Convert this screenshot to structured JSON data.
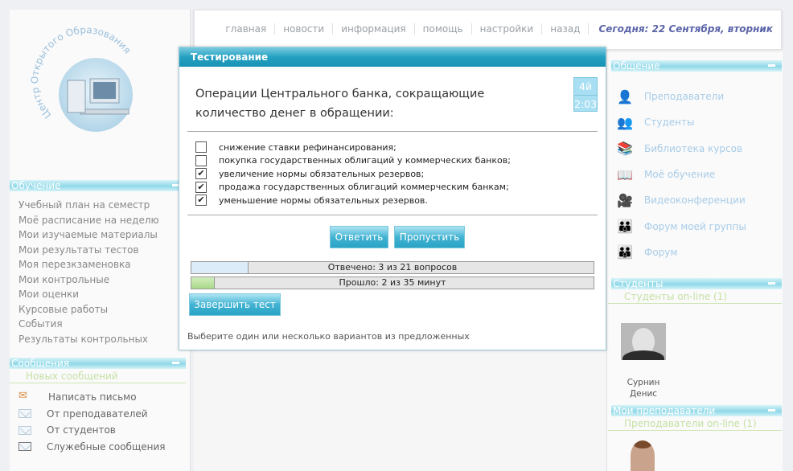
{
  "nav": {
    "items": [
      "главная",
      "новости",
      "информация",
      "помощь",
      "настройки",
      "назад"
    ],
    "date": "Сегодня: 22 Сентября, вторник"
  },
  "logo": {
    "text": "Центр Открытого Образования"
  },
  "left": {
    "study_title": "Обучение",
    "study_items": [
      "Учебный план на семестр",
      "Моё расписание на неделю",
      "Мои изучаемые материалы",
      "Мои результаты тестов",
      "Моя перезкзаменовка",
      "Мои контрольные",
      "Мои оценки",
      "Курсовые работы",
      "События",
      "Результаты контрольных"
    ],
    "messages_title": "Сообщения",
    "messages_new": "Новых сообщений",
    "message_items": [
      "Написать письмо",
      "От преподавателей",
      "От студентов",
      "Служебные сообщения"
    ]
  },
  "right": {
    "comm_title": "Общение",
    "comm_items": [
      {
        "label": "Преподаватели",
        "icon": "teacher-icon"
      },
      {
        "label": "Студенты",
        "icon": "students-icon"
      },
      {
        "label": "Библиотека курсов",
        "icon": "books-icon"
      },
      {
        "label": "Моё обучение",
        "icon": "book-open-icon"
      },
      {
        "label": "Видеоконференции",
        "icon": "camera-icon"
      },
      {
        "label": "Форум моей группы",
        "icon": "group-forum-icon"
      },
      {
        "label": "Форум",
        "icon": "forum-icon"
      }
    ],
    "students_title": "Студенты",
    "students_online": "Студенты on-line (1)",
    "student_first": "Сурнин",
    "student_last": "Денис",
    "teachers_title": "Мои преподаватели",
    "teachers_online": "Преподаватели on-line (1)"
  },
  "dialog": {
    "title": "Тестирование",
    "question": "Операции Центрального банка, сокращающие количество денег в обращении:",
    "timer_top": "4й",
    "timer_bottom": "2:03",
    "options": [
      {
        "text": "снижение ставки рефинансирования;",
        "checked": false
      },
      {
        "text": "покупка государственных облигаций у коммерческих банков;",
        "checked": false
      },
      {
        "text": "увеличение нормы обязательных резервов;",
        "checked": true
      },
      {
        "text": "продажа государственных облигаций коммерческим банкам;",
        "checked": true
      },
      {
        "text": "уменьшение нормы обязательных резервов.",
        "checked": true
      }
    ],
    "answer_label": "Ответить",
    "skip_label": "Пропустить",
    "answered_text": "Отвечено: 3 из 21 вопросов",
    "answered_fraction": 0.1429,
    "elapsed_text": "Прошло: 2 из 35 минут",
    "elapsed_fraction": 0.0571,
    "finish_label": "Завершить тест",
    "hint": "Выберите один или несколько вариантов из предложенных"
  },
  "colors": {
    "accent": "#23a0c1",
    "date": "#5a64a8",
    "progress_answered": "#dcecf8",
    "progress_elapsed": "#a8d889"
  }
}
